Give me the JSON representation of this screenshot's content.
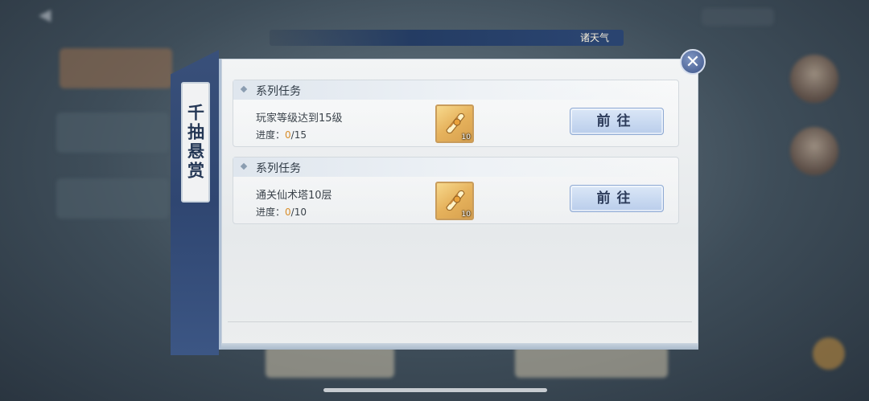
{
  "header": {
    "bar_title": "诸天气"
  },
  "panel": {
    "title": "千抽悬赏",
    "close_icon": "close-icon"
  },
  "tasks": [
    {
      "type": "系列任务",
      "description": "玩家等级达到15级",
      "progress_label": "进度：",
      "progress_current": "0",
      "progress_total": "/15",
      "reward_icon": "scroll-item-icon",
      "reward_count": "10",
      "button_label": "前往"
    },
    {
      "type": "系列任务",
      "description": "通关仙术塔10层",
      "progress_label": "进度：",
      "progress_current": "0",
      "progress_total": "/10",
      "reward_icon": "scroll-item-icon",
      "reward_count": "10",
      "button_label": "前往"
    }
  ],
  "colors": {
    "accent_blue": "#2f4671",
    "progress_orange": "#d98e2b",
    "button_blue": "#b9cdeb"
  }
}
